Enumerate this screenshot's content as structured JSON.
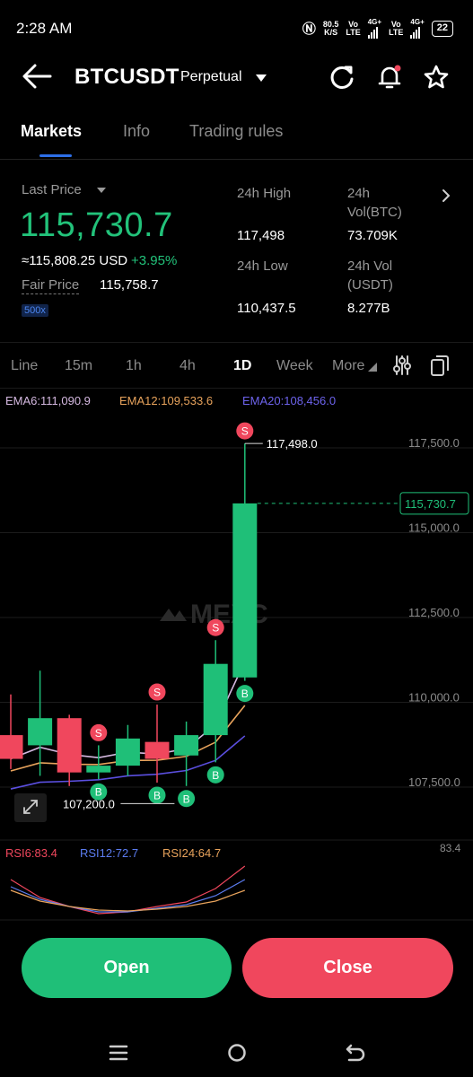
{
  "status_bar": {
    "time": "2:28 AM",
    "net_speed_top": "80.5",
    "net_speed_bottom": "K/S",
    "sim1_top": "Vo",
    "sim1_bottom": "LTE",
    "sim1_gen": "4G+",
    "sim2_top": "Vo",
    "sim2_bottom": "LTE",
    "sim2_gen": "4G+",
    "battery": "22"
  },
  "header": {
    "pair": "BTCUSDT",
    "contract_type": "Perpetual",
    "icons": [
      "back-arrow-icon",
      "refresh-icon",
      "bell-icon",
      "star-icon"
    ]
  },
  "tabs": [
    "Markets",
    "Info",
    "Trading rules"
  ],
  "price": {
    "last_price_label": "Last Price",
    "last_price": "115,730.7",
    "usd_equiv": "≈115,808.25 USD",
    "change": "+3.95%",
    "fair_price_label": "Fair Price",
    "fair_price": "115,758.7",
    "leverage": "500x"
  },
  "stats": {
    "high_label": "24h High",
    "high": "117,498",
    "low_label": "24h Low",
    "low": "110,437.5",
    "vol_btc_label": "24h\nVol(BTC)",
    "vol_btc": "73.709K",
    "vol_usdt_label": "24h Vol\n(USDT)",
    "vol_usdt": "8.277B"
  },
  "timeframes": [
    "Line",
    "15m",
    "1h",
    "4h",
    "1D",
    "Week",
    "More"
  ],
  "active_timeframe": "1D",
  "ema_legend": {
    "ema6": "EMA6:111,090.9",
    "ema12": "EMA12:109,533.6",
    "ema20": "EMA20:108,456.0"
  },
  "rsi_legend": {
    "rsi6": "RSI6:83.4",
    "rsi12": "RSI12:72.7",
    "rsi24": "RSI24:64.7",
    "scale_top": "83.4"
  },
  "chart_data": {
    "type": "candlestick",
    "price_axis_labels": [
      "117,500.0",
      "115,000.0",
      "112,500.0",
      "110,000.0",
      "107,500.0"
    ],
    "price_axis_values": [
      117500,
      115000,
      112500,
      110000,
      107500
    ],
    "current_price_tag": "115,730.7",
    "current_price": 115730.7,
    "high_marker": "117,498.0",
    "high_value": 117498,
    "low_marker": "107,200.0",
    "low_value": 107200,
    "watermark": "MEXC",
    "candles": [
      {
        "open": 108900,
        "close": 108200,
        "high": 110100,
        "low": 107900
      },
      {
        "open": 108600,
        "close": 109400,
        "high": 110800,
        "low": 107700
      },
      {
        "open": 109400,
        "close": 107800,
        "high": 109500,
        "low": 107400
      },
      {
        "open": 107800,
        "close": 108000,
        "high": 108600,
        "low": 107600
      },
      {
        "open": 108000,
        "close": 108800,
        "high": 109200,
        "low": 107700
      },
      {
        "open": 108700,
        "close": 108200,
        "high": 109800,
        "low": 107500
      },
      {
        "open": 108300,
        "close": 108900,
        "high": 109300,
        "low": 107400
      },
      {
        "open": 108900,
        "close": 111000,
        "high": 111700,
        "low": 108100
      },
      {
        "open": 110600,
        "close": 115730.7,
        "high": 117498,
        "low": 110500
      }
    ],
    "signals": [
      {
        "candle": 3,
        "type": "S",
        "where": "above"
      },
      {
        "candle": 3,
        "type": "B",
        "where": "below"
      },
      {
        "candle": 5,
        "type": "S",
        "where": "above"
      },
      {
        "candle": 5,
        "type": "B",
        "where": "below"
      },
      {
        "candle": 6,
        "type": "B",
        "where": "below"
      },
      {
        "candle": 7,
        "type": "S",
        "where": "above"
      },
      {
        "candle": 7,
        "type": "B",
        "where": "below"
      },
      {
        "candle": 8,
        "type": "S",
        "where": "above"
      },
      {
        "candle": 8,
        "type": "B",
        "where": "below"
      }
    ],
    "colors": {
      "up": "#1fbf78",
      "down": "#f0475d",
      "ema6": "#d4b8e0",
      "ema12": "#e8a35c",
      "ema20": "#5b4fe0",
      "grid": "#1c1c1c"
    }
  },
  "buttons": {
    "open": "Open",
    "close": "Close"
  },
  "navbar": {
    "icons": [
      "recents-icon",
      "home-icon",
      "back-icon"
    ]
  }
}
